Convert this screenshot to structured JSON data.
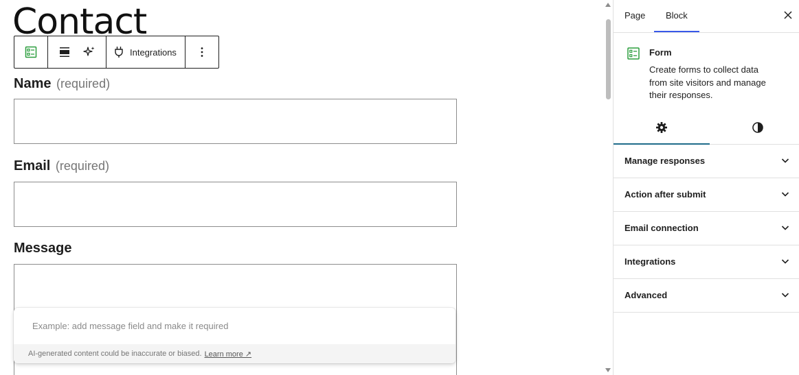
{
  "canvas": {
    "title": "Contact",
    "toolbar": {
      "integrations_label": "Integrations"
    },
    "fields": [
      {
        "label": "Name",
        "required_text": "(required)"
      },
      {
        "label": "Email",
        "required_text": "(required)"
      },
      {
        "label": "Message",
        "required_text": ""
      }
    ],
    "ai_prompt": {
      "placeholder": "Example: add message field and make it required",
      "disclaimer": "AI-generated content could be inaccurate or biased.",
      "learn_more": "Learn more ↗"
    }
  },
  "sidebar": {
    "tabs": [
      {
        "label": "Page"
      },
      {
        "label": "Block"
      }
    ],
    "block": {
      "title": "Form",
      "description": "Create forms to collect data from site visitors and manage their responses."
    },
    "panels": [
      {
        "label": "Manage responses"
      },
      {
        "label": "Action after submit"
      },
      {
        "label": "Email connection"
      },
      {
        "label": "Integrations"
      },
      {
        "label": "Advanced"
      }
    ]
  },
  "colors": {
    "form_icon": "#2a9d3c",
    "active_tab": "#3858e9",
    "settings_tab_underline": "#1e6b8a"
  }
}
